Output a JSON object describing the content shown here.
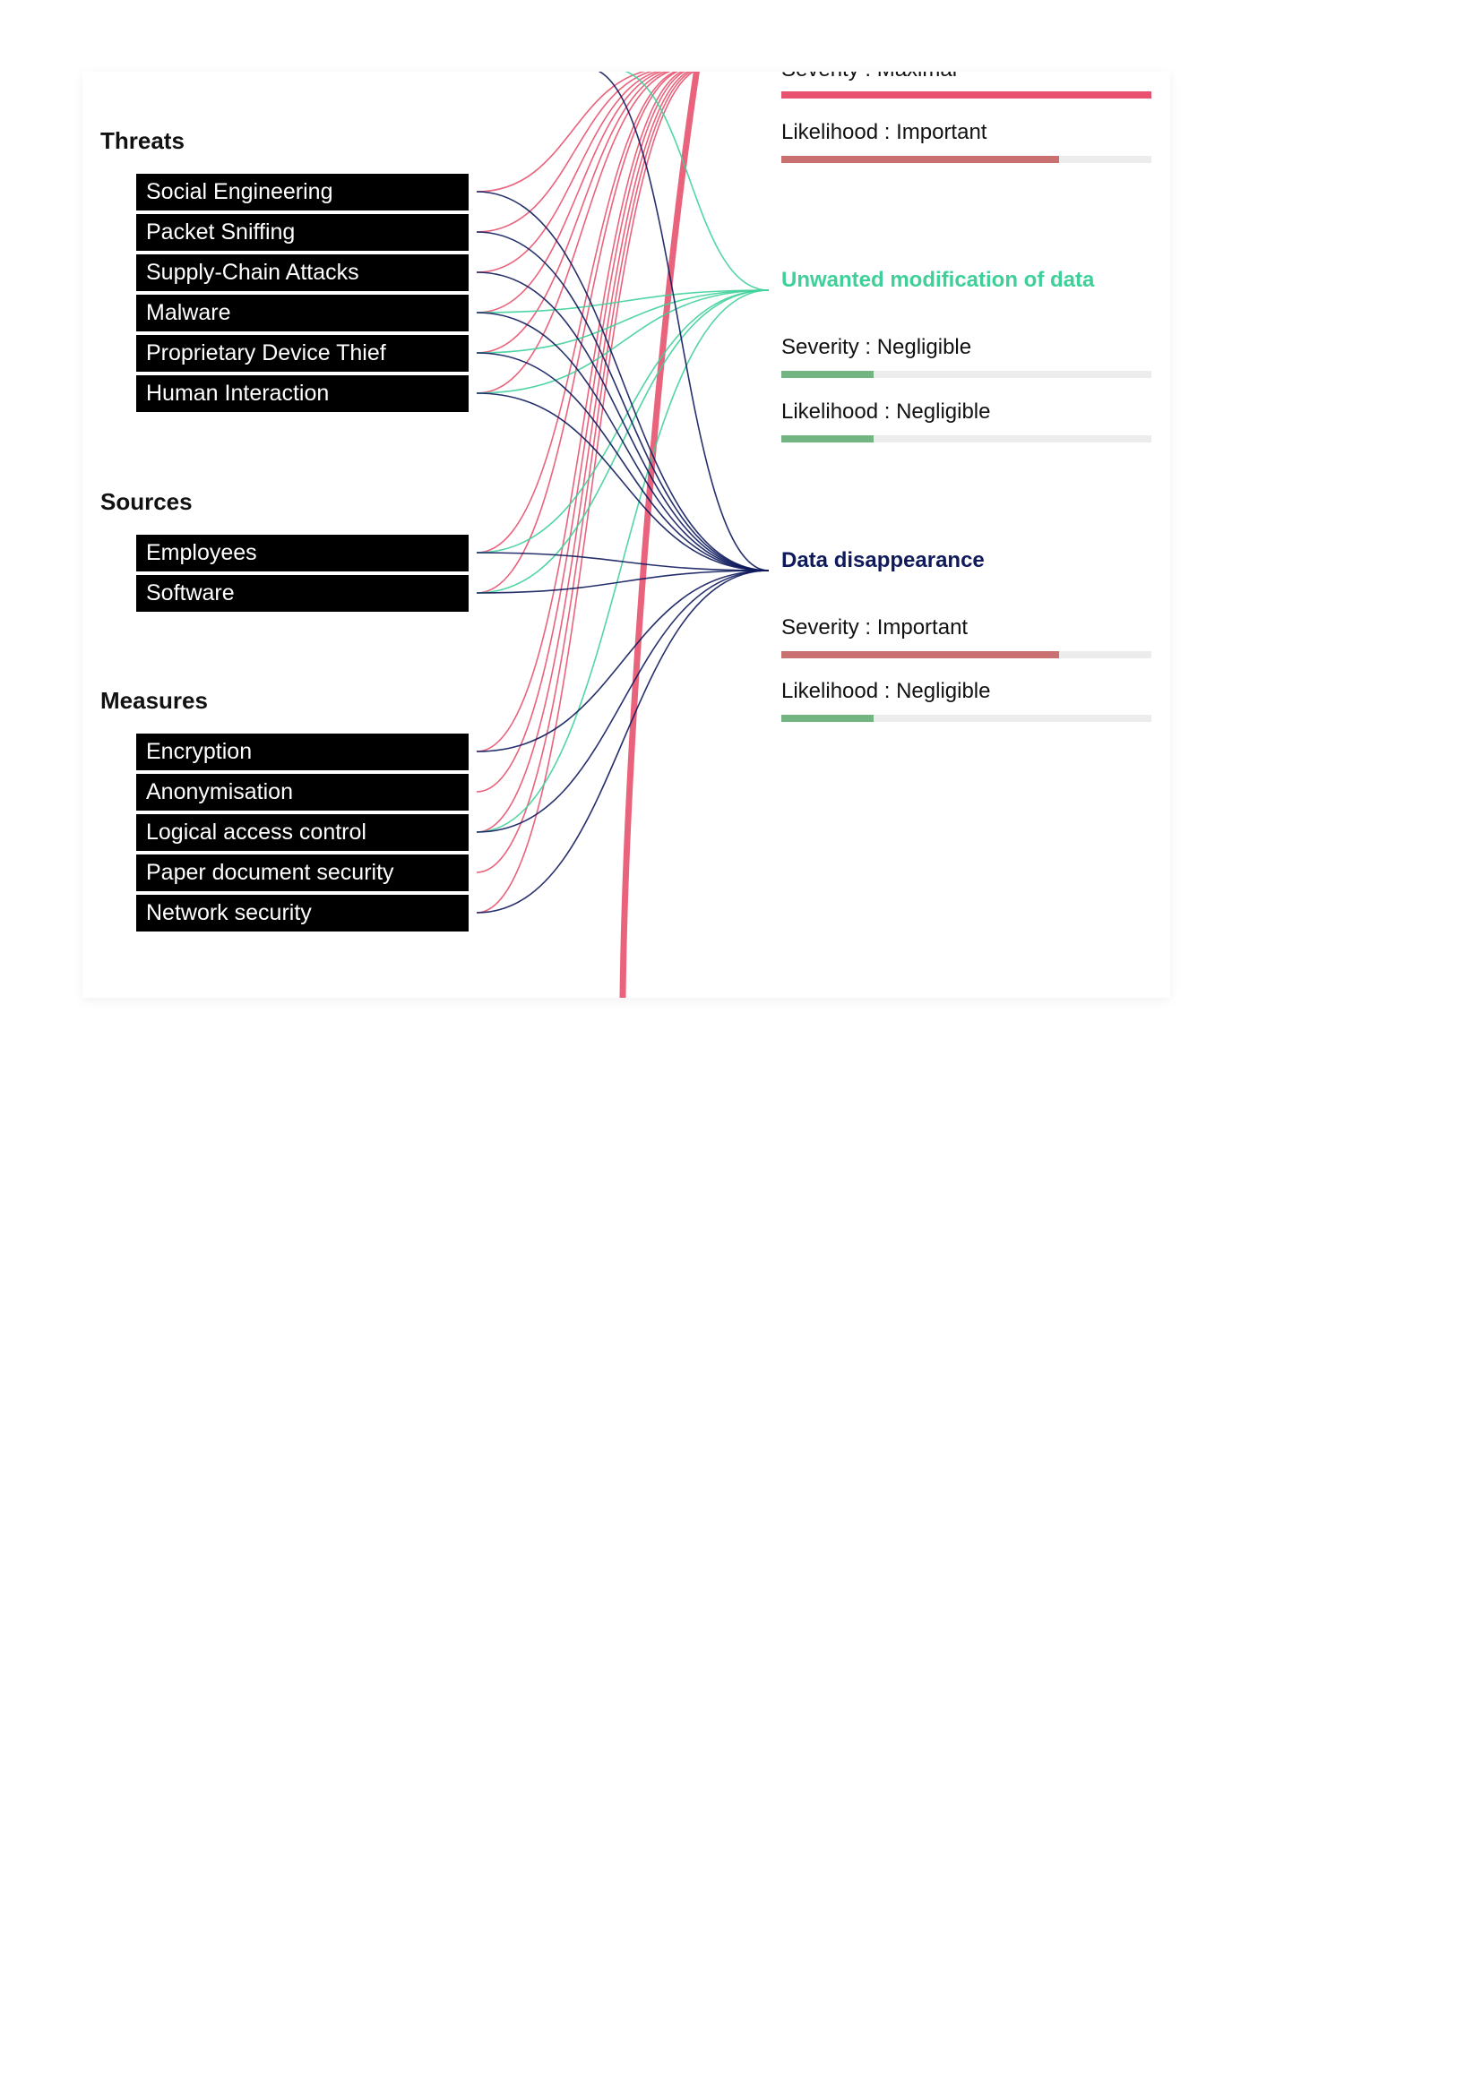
{
  "sections": {
    "threats": {
      "title": "Threats",
      "items": [
        "Social Engineering",
        "Packet Sniffing",
        "Supply-Chain Attacks",
        "Malware",
        "Proprietary Device Thief",
        "Human Interaction"
      ]
    },
    "sources": {
      "title": "Sources",
      "items": [
        "Employees",
        "Software"
      ]
    },
    "measures": {
      "title": "Measures",
      "items": [
        "Encryption",
        "Anonymisation",
        "Logical access control",
        "Paper document security",
        "Network security"
      ]
    }
  },
  "impacts": [
    {
      "id": "illegitimate",
      "color": "#e8526f",
      "severity": {
        "label": "Severity : Maximal",
        "level": 1.0,
        "color": "#e8526f"
      },
      "likelihood": {
        "label": "Likelihood : Important",
        "level": 0.75,
        "color": "#c97070"
      }
    },
    {
      "id": "modification",
      "title": "Unwanted modification of data",
      "color": "#3fd09a",
      "severity": {
        "label": "Severity : Negligible",
        "level": 0.25,
        "color": "#72b482"
      },
      "likelihood": {
        "label": "Likelihood : Negligible",
        "level": 0.25,
        "color": "#72b482"
      }
    },
    {
      "id": "disappearance",
      "title": "Data disappearance",
      "color": "#0e1a5c",
      "severity": {
        "label": "Severity : Important",
        "level": 0.75,
        "color": "#c97070"
      },
      "likelihood": {
        "label": "Likelihood : Negligible",
        "level": 0.25,
        "color": "#72b482"
      }
    }
  ],
  "colors": {
    "background": "#ffffff",
    "item_box": "#000000",
    "item_text": "#ffffff",
    "track": "#ececec"
  }
}
